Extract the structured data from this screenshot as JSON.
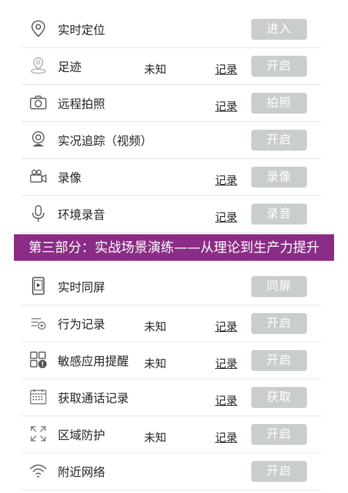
{
  "rows": [
    {
      "label": "实时定位",
      "status": "",
      "record": "",
      "button": "进入",
      "icon": "location-pin-icon"
    },
    {
      "label": "足迹",
      "status": "未知",
      "record": "记录",
      "button": "开启",
      "icon": "footprint-pin-icon"
    },
    {
      "label": "远程拍照",
      "status": "",
      "record": "记录",
      "button": "拍照",
      "icon": "camera-icon"
    },
    {
      "label": "实况追踪（视频）",
      "status": "",
      "record": "",
      "button": "开启",
      "icon": "webcam-icon"
    },
    {
      "label": "录像",
      "status": "",
      "record": "记录",
      "button": "录像",
      "icon": "video-camera-icon"
    },
    {
      "label": "环境录音",
      "status": "",
      "record": "记录",
      "button": "录音",
      "icon": "microphone-icon"
    },
    {
      "label": "实时同屏",
      "status": "",
      "record": "",
      "button": "同屏",
      "icon": "tablet-play-icon"
    },
    {
      "label": "行为记录",
      "status": "未知",
      "record": "记录",
      "button": "开启",
      "icon": "behavior-log-icon"
    },
    {
      "label": "敏感应用提醒",
      "status": "未知",
      "record": "记录",
      "button": "开启",
      "icon": "app-alert-icon"
    },
    {
      "label": "获取通话记录",
      "status": "",
      "record": "记录",
      "button": "获取",
      "icon": "calendar-call-log-icon"
    },
    {
      "label": "区域防护",
      "status": "未知",
      "record": "记录",
      "button": "开启",
      "icon": "expand-arrows-icon"
    },
    {
      "label": "附近网络",
      "status": "",
      "record": "",
      "button": "开启",
      "icon": "wifi-icon"
    }
  ],
  "banner": {
    "text": "第三部分：实战场景演练——从理论到生产力提升"
  },
  "colors": {
    "button_bg": "#c9cdcd",
    "banner_bg": "#8b2d86",
    "divider": "#e6e6e6"
  }
}
